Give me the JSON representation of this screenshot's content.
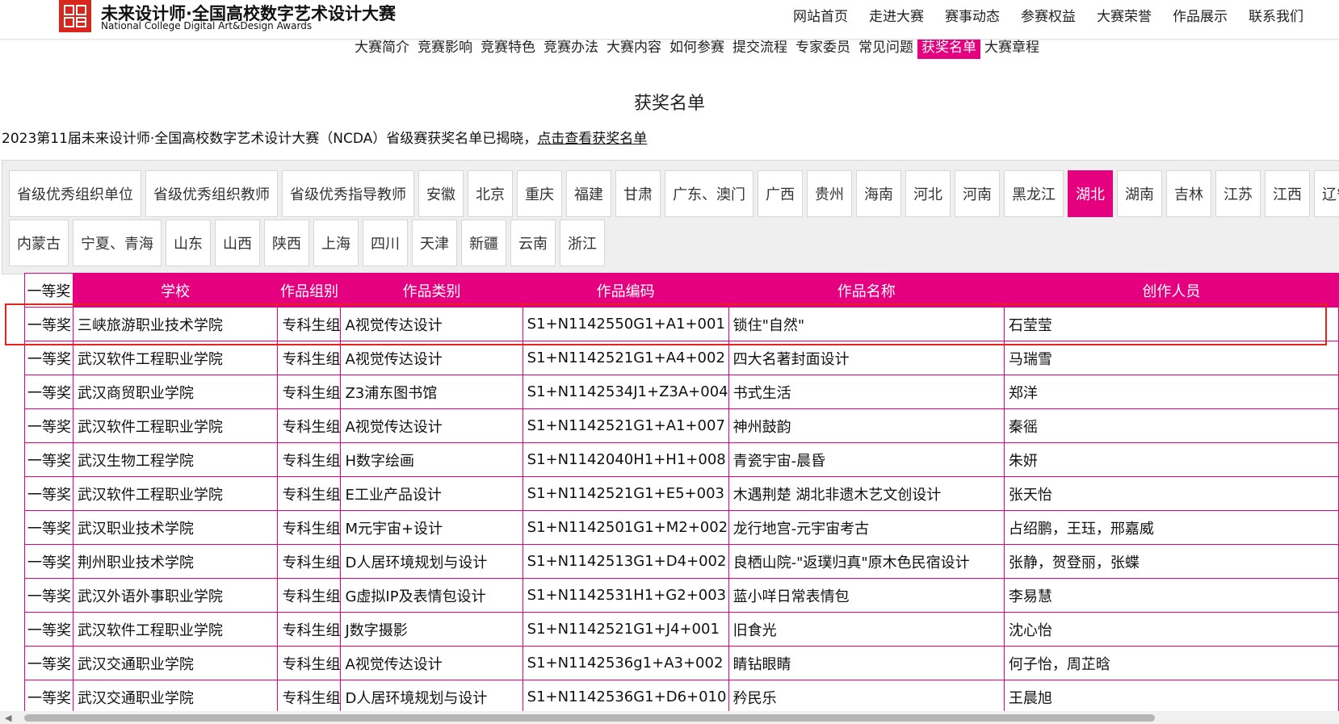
{
  "brand": {
    "title_cn": "未来设计师·全国高校数字艺术设计大赛",
    "title_en": "National College Digital Art&Design Awards"
  },
  "top_nav": [
    "网站首页",
    "走进大赛",
    "赛事动态",
    "参赛权益",
    "大赛荣誉",
    "作品展示",
    "联系我们"
  ],
  "sub_nav": {
    "items": [
      "大赛简介",
      "竞赛影响",
      "竞赛特色",
      "竞赛办法",
      "大赛内容",
      "如何参赛",
      "提交流程",
      "专家委员",
      "常见问题",
      "获奖名单",
      "大赛章程"
    ],
    "active": "获奖名单"
  },
  "page_title": "获奖名单",
  "notice": {
    "text": "2023第11届未来设计师·全国高校数字艺术设计大赛（NCDA）省级赛获奖名单已揭晓，",
    "link": "点击查看获奖名单"
  },
  "region_tabs": {
    "row1": [
      "省级优秀组织单位",
      "省级优秀组织教师",
      "省级优秀指导教师",
      "安徽",
      "北京",
      "重庆",
      "福建",
      "甘肃",
      "广东、澳门",
      "广西",
      "贵州",
      "海南",
      "河北",
      "河南",
      "黑龙江",
      "湖北",
      "湖南",
      "吉林",
      "江苏",
      "江西",
      "辽宁"
    ],
    "row2": [
      "内蒙古",
      "宁夏、青海",
      "山东",
      "山西",
      "陕西",
      "上海",
      "四川",
      "天津",
      "新疆",
      "云南",
      "浙江"
    ],
    "active": "湖北"
  },
  "table": {
    "headers": [
      "一等奖",
      "学校",
      "作品组别",
      "作品类别",
      "作品编码",
      "作品名称",
      "创作人员"
    ],
    "rows": [
      [
        "一等奖",
        "三峡旅游职业技术学院",
        "专科生组",
        "A视觉传达设计",
        "S1+N1142550G1+A1+001",
        "锁住\"自然\"",
        "石莹莹"
      ],
      [
        "一等奖",
        "武汉软件工程职业学院",
        "专科生组",
        "A视觉传达设计",
        "S1+N1142521G1+A4+002",
        "四大名著封面设计",
        "马瑞雪"
      ],
      [
        "一等奖",
        "武汉商贸职业学院",
        "专科生组",
        "Z3浦东图书馆",
        "S1+N1142534J1+Z3A+004",
        "书式生活",
        "郑洋"
      ],
      [
        "一等奖",
        "武汉软件工程职业学院",
        "专科生组",
        "A视觉传达设计",
        "S1+N1142521G1+A1+007",
        "神州鼓韵",
        "秦徭"
      ],
      [
        "一等奖",
        "武汉生物工程学院",
        "专科生组",
        "H数字绘画",
        "S1+N1142040H1+H1+008",
        "青瓷宇宙-晨昏",
        "朱妍"
      ],
      [
        "一等奖",
        "武汉软件工程职业学院",
        "专科生组",
        "E工业产品设计",
        "S1+N1142521G1+E5+003",
        "木遇荆楚 湖北非遗木艺文创设计",
        "张天怡"
      ],
      [
        "一等奖",
        "武汉职业技术学院",
        "专科生组",
        "M元宇宙+设计",
        "S1+N1142501G1+M2+002",
        "龙行地宫-元宇宙考古",
        "占绍鹏，王珏，邢嘉威"
      ],
      [
        "一等奖",
        "荆州职业技术学院",
        "专科生组",
        "D人居环境规划与设计",
        "S1+N1142513G1+D4+002",
        "良栖山院-\"返璞归真\"原木色民宿设计",
        "张静，贺登丽，张蝶"
      ],
      [
        "一等奖",
        "武汉外语外事职业学院",
        "专科生组",
        "G虚拟IP及表情包设计",
        "S1+N1142531H1+G2+003",
        "蓝小咩日常表情包",
        "李易慧"
      ],
      [
        "一等奖",
        "武汉软件工程职业学院",
        "专科生组",
        "J数字摄影",
        "S1+N1142521G1+J4+001",
        "旧食光",
        "沈心怡"
      ],
      [
        "一等奖",
        "武汉交通职业学院",
        "专科生组",
        "A视觉传达设计",
        "S1+N1142536g1+A3+002",
        "睛钻眼睛",
        "何子怡，周芷晗"
      ],
      [
        "一等奖",
        "武汉交通职业学院",
        "专科生组",
        "D人居环境规划与设计",
        "S1+N1142536G1+D6+010",
        "矜民乐",
        "王晨旭"
      ]
    ]
  },
  "accent_color": "#e4007f",
  "highlight_color": "#e8211d",
  "logo_color": "#d9261c"
}
